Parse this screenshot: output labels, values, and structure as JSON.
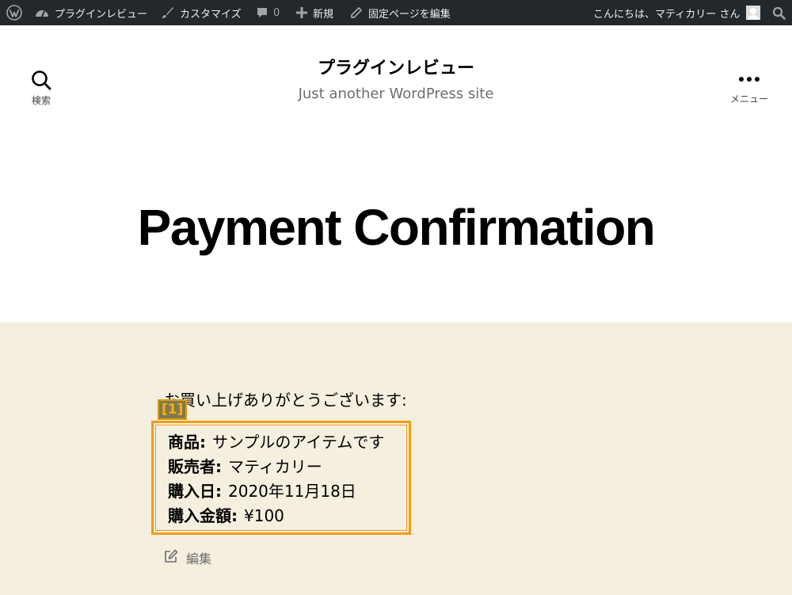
{
  "admin_bar": {
    "site_name": "プラグインレビュー",
    "customize": "カスタマイズ",
    "comments_count": "0",
    "new": "新規",
    "edit_page": "固定ページを編集",
    "greeting": "こんにちは、マティカリー さん"
  },
  "header": {
    "search_label": "検索",
    "site_title": "プラグインレビュー",
    "site_description": "Just another WordPress site",
    "menu_label": "メニュー"
  },
  "page": {
    "title": "Payment Confirmation",
    "thanks": "お買い上げありがとうございます:",
    "marker": "[1]",
    "details": [
      {
        "label": "商品:",
        "value": "サンプルのアイテムです"
      },
      {
        "label": "販売者:",
        "value": "マティカリー"
      },
      {
        "label": "購入日:",
        "value": "2020年11月18日"
      },
      {
        "label": "購入金額:",
        "value": "¥100"
      }
    ],
    "edit_label": "編集"
  },
  "colors": {
    "admin_bar_bg": "#23282d",
    "content_bg": "#f5efe0",
    "highlight_border": "#f39c12"
  }
}
